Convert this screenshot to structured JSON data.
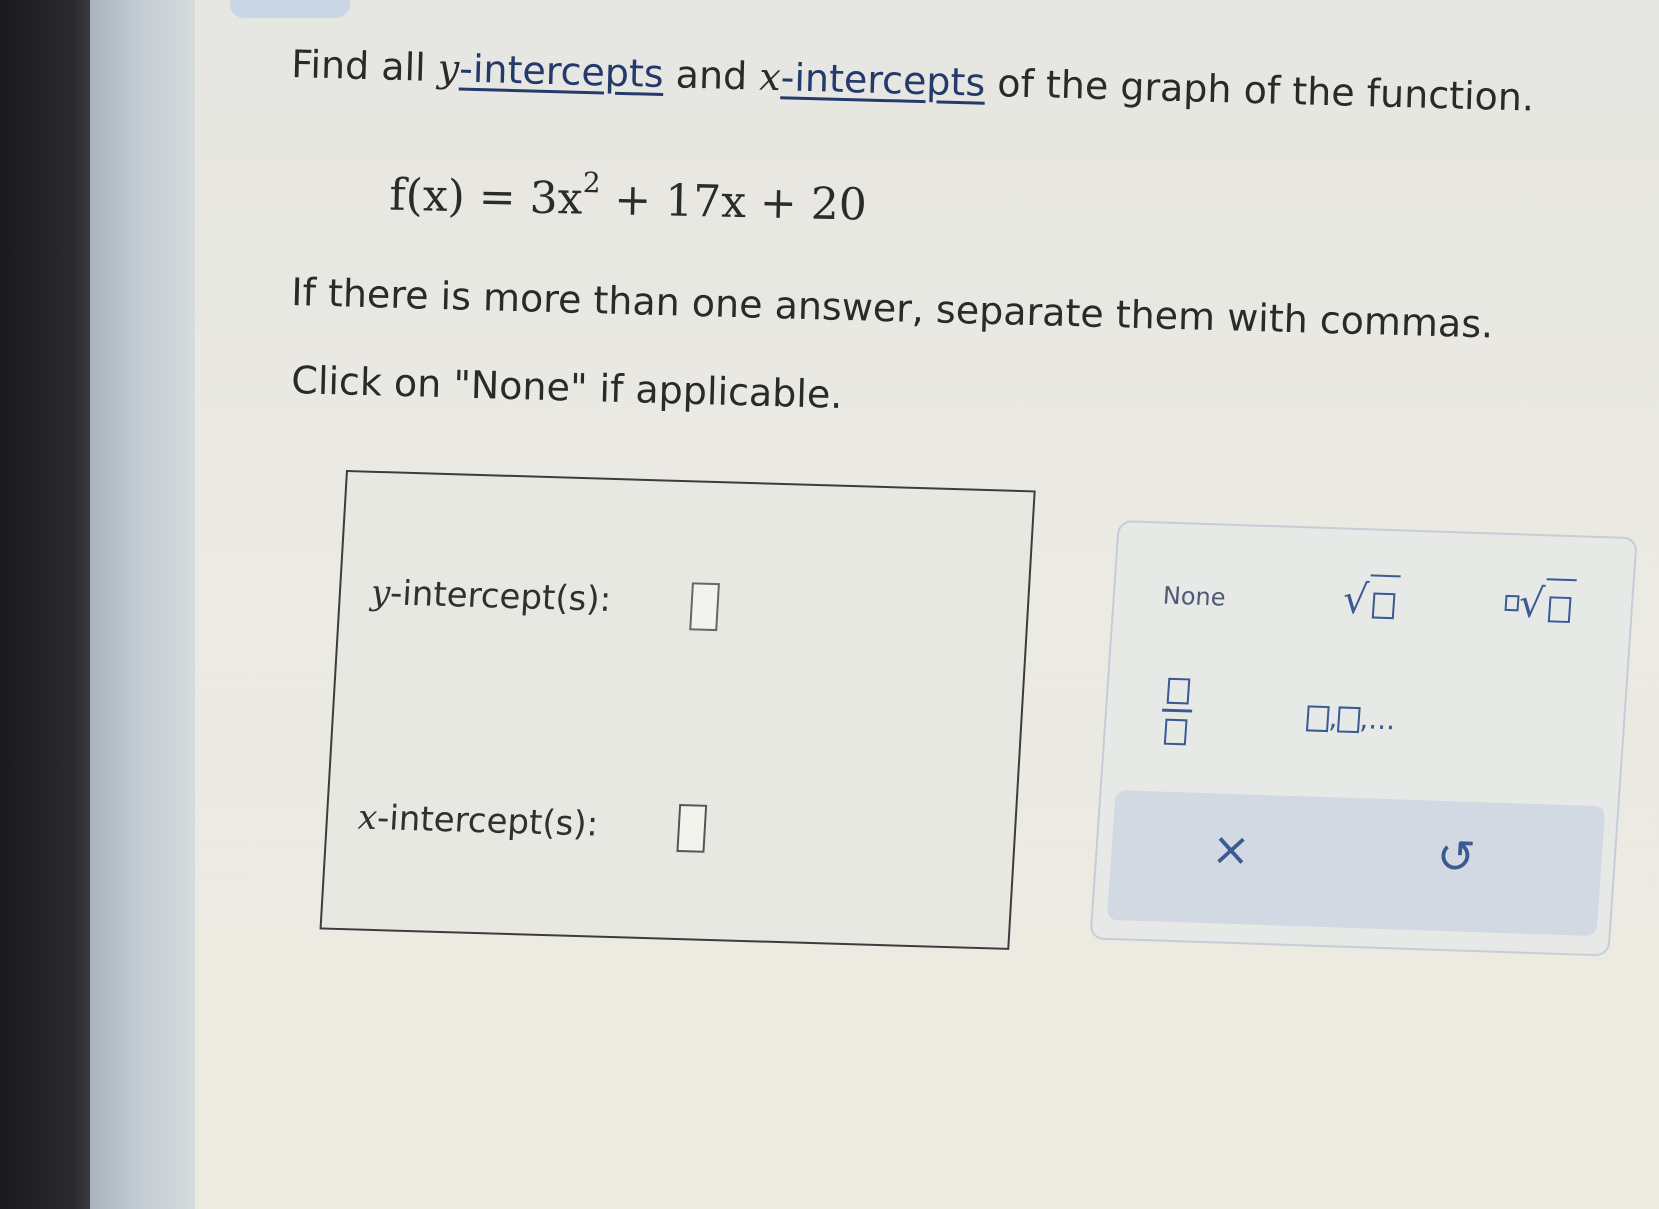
{
  "question": {
    "intro_prefix": "Find all",
    "y_var": "y",
    "y_link": "-intercepts",
    "and_text": "and",
    "x_var": "x",
    "x_link": "-intercepts",
    "intro_suffix": "of the graph of the function.",
    "formula_lhs": "f(x) = 3x",
    "formula_exp": "2",
    "formula_rhs": "+ 17x + 20",
    "instruction_1": "If there is more than one answer, separate them with commas.",
    "instruction_2": "Click on \"None\" if applicable."
  },
  "answer": {
    "y_label_var": "y",
    "y_label_text": "-intercept(s):",
    "y_value": "",
    "x_label_var": "x",
    "x_label_text": "-intercept(s):",
    "x_value": ""
  },
  "keypad": {
    "none_label": "None",
    "sqrt_icon": "square-root-icon",
    "nth_root_icon": "nth-root-icon",
    "fraction_icon": "fraction-icon",
    "list_icon": "list-icon",
    "clear_icon": "clear-x-icon",
    "clear_glyph": "×",
    "undo_icon": "undo-icon",
    "undo_glyph": "↺"
  },
  "colors": {
    "link": "#243a6c",
    "keypad_accent": "#3a5a92"
  }
}
